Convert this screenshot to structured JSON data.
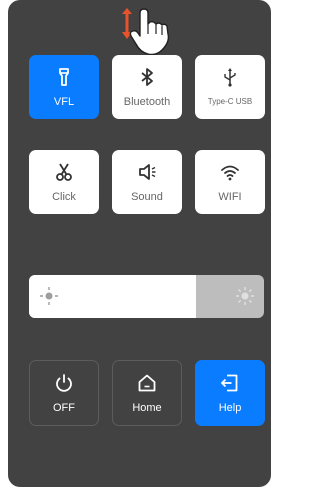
{
  "tiles": {
    "vfl": "VFL",
    "bluetooth": "Bluetooth",
    "typec": "Type-C USB",
    "click": "Click",
    "sound": "Sound",
    "wifi": "WIFI"
  },
  "brightness": {
    "level_fraction": 0.71
  },
  "bottom": {
    "off": "OFF",
    "home": "Home",
    "help": "Help"
  },
  "colors": {
    "panel": "#424242",
    "accent": "#0a7cff",
    "hint_arrow": "#e8532b"
  }
}
